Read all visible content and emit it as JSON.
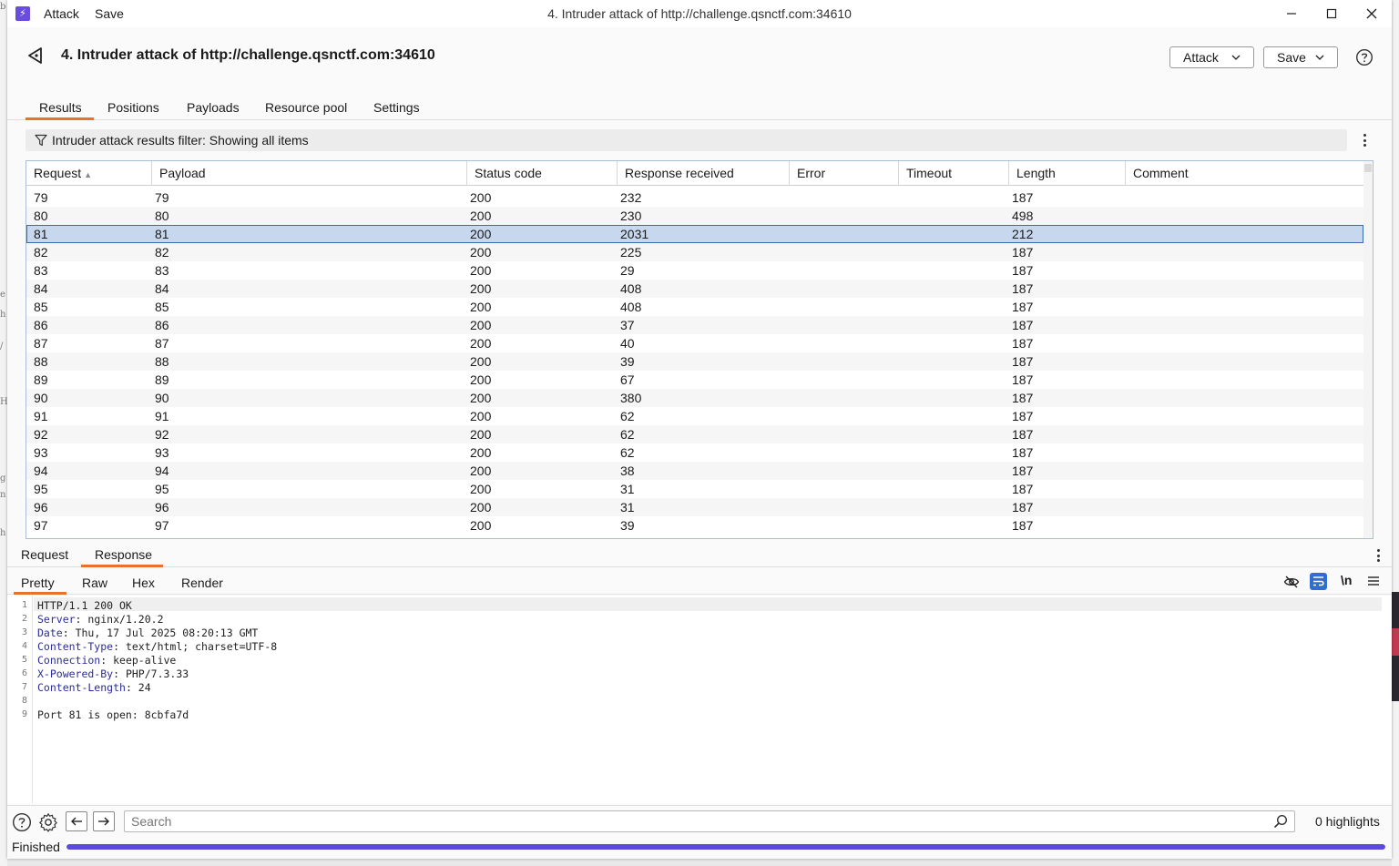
{
  "app": {
    "menu": [
      "Attack",
      "Save"
    ],
    "window_title": "4. Intruder attack of http://challenge.qsnctf.com:34610"
  },
  "header": {
    "title": "4. Intruder attack of http://challenge.qsnctf.com:34610",
    "attack_label": "Attack",
    "save_label": "Save"
  },
  "tabs": [
    "Results",
    "Positions",
    "Payloads",
    "Resource pool",
    "Settings"
  ],
  "active_tab": "Results",
  "filter": {
    "text": "Intruder attack results filter: Showing all items"
  },
  "table": {
    "columns": [
      "Request",
      "Payload",
      "Status code",
      "Response received",
      "Error",
      "Timeout",
      "Length",
      "Comment"
    ],
    "sorted_column": "Request",
    "selected_request": "81",
    "rows": [
      [
        "79",
        "79",
        "200",
        "232",
        "",
        "",
        "187",
        ""
      ],
      [
        "80",
        "80",
        "200",
        "230",
        "",
        "",
        "498",
        ""
      ],
      [
        "81",
        "81",
        "200",
        "2031",
        "",
        "",
        "212",
        ""
      ],
      [
        "82",
        "82",
        "200",
        "225",
        "",
        "",
        "187",
        ""
      ],
      [
        "83",
        "83",
        "200",
        "29",
        "",
        "",
        "187",
        ""
      ],
      [
        "84",
        "84",
        "200",
        "408",
        "",
        "",
        "187",
        ""
      ],
      [
        "85",
        "85",
        "200",
        "408",
        "",
        "",
        "187",
        ""
      ],
      [
        "86",
        "86",
        "200",
        "37",
        "",
        "",
        "187",
        ""
      ],
      [
        "87",
        "87",
        "200",
        "40",
        "",
        "",
        "187",
        ""
      ],
      [
        "88",
        "88",
        "200",
        "39",
        "",
        "",
        "187",
        ""
      ],
      [
        "89",
        "89",
        "200",
        "67",
        "",
        "",
        "187",
        ""
      ],
      [
        "90",
        "90",
        "200",
        "380",
        "",
        "",
        "187",
        ""
      ],
      [
        "91",
        "91",
        "200",
        "62",
        "",
        "",
        "187",
        ""
      ],
      [
        "92",
        "92",
        "200",
        "62",
        "",
        "",
        "187",
        ""
      ],
      [
        "93",
        "93",
        "200",
        "62",
        "",
        "",
        "187",
        ""
      ],
      [
        "94",
        "94",
        "200",
        "38",
        "",
        "",
        "187",
        ""
      ],
      [
        "95",
        "95",
        "200",
        "31",
        "",
        "",
        "187",
        ""
      ],
      [
        "96",
        "96",
        "200",
        "31",
        "",
        "",
        "187",
        ""
      ],
      [
        "97",
        "97",
        "200",
        "39",
        "",
        "",
        "187",
        ""
      ]
    ]
  },
  "message_tabs": [
    "Request",
    "Response"
  ],
  "active_message_tab": "Response",
  "view_tabs": [
    "Pretty",
    "Raw",
    "Hex",
    "Render"
  ],
  "active_view_tab": "Pretty",
  "view_toggle_newline_label": "\\n",
  "response": {
    "lines": [
      {
        "n": "1",
        "key": "",
        "value": "HTTP/1.1 200 OK"
      },
      {
        "n": "2",
        "key": "Server",
        "value": " nginx/1.20.2"
      },
      {
        "n": "3",
        "key": "Date",
        "value": " Thu, 17 Jul 2025 08:20:13 GMT"
      },
      {
        "n": "4",
        "key": "Content-Type",
        "value": " text/html; charset=UTF-8"
      },
      {
        "n": "5",
        "key": "Connection",
        "value": " keep-alive"
      },
      {
        "n": "6",
        "key": "X-Powered-By",
        "value": " PHP/7.3.33"
      },
      {
        "n": "7",
        "key": "Content-Length",
        "value": " 24"
      },
      {
        "n": "8",
        "key": "",
        "value": ""
      },
      {
        "n": "9",
        "key": "",
        "value": "Port 81 is open: 8cbfa7d"
      }
    ]
  },
  "search": {
    "placeholder": "Search",
    "highlights": "0 highlights"
  },
  "status": {
    "text": "Finished",
    "progress": 1.0
  },
  "colors": {
    "accent": "#e8722c",
    "selection": "#c6d7ee",
    "progress": "#5b49e0",
    "logo": "#6a4ce0"
  }
}
